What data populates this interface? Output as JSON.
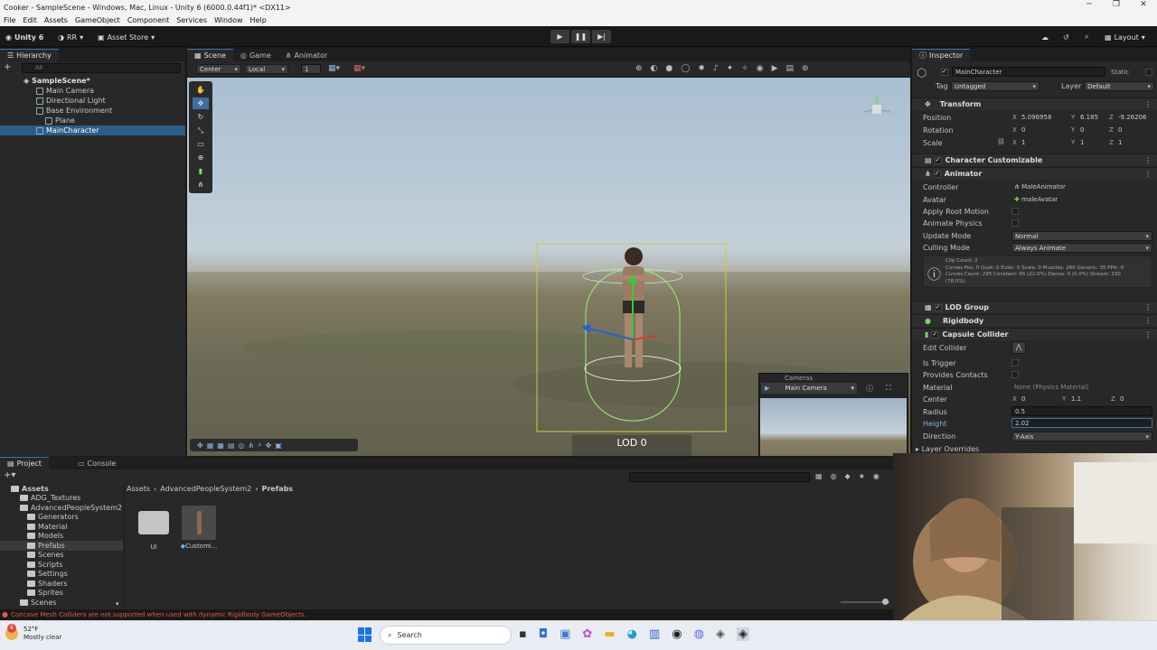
{
  "window": {
    "title": "Cooker - SampleScene - Windows, Mac, Linux - Unity 6 (6000.0.44f1)* <DX11>"
  },
  "menu": [
    "File",
    "Edit",
    "Assets",
    "GameObject",
    "Component",
    "Services",
    "Window",
    "Help"
  ],
  "toolbar": {
    "account": "Unity 6",
    "initials": "RR",
    "asset_store": "Asset Store",
    "layout": "Layout"
  },
  "hierarchy": {
    "tab": "Hierarchy",
    "search_placeholder": "All",
    "items": [
      {
        "label": "SampleScene*",
        "indent": 0
      },
      {
        "label": "Main Camera",
        "indent": 1
      },
      {
        "label": "Directional Light",
        "indent": 1
      },
      {
        "label": "Base Environment",
        "indent": 1
      },
      {
        "label": "Plane",
        "indent": 2
      },
      {
        "label": "MainCharacter",
        "indent": 1
      }
    ]
  },
  "scene": {
    "tabs": [
      "Scene",
      "Game",
      "Animator"
    ],
    "pivot": "Center",
    "space": "Local",
    "grid": "1",
    "lod_label": "LOD 0",
    "cameras_title": "Cameras",
    "camera_select": "Main Camera"
  },
  "inspector": {
    "tab": "Inspector",
    "object_name": "MainCharacter",
    "static_label": "Static",
    "tag_label": "Tag",
    "tag_value": "Untagged",
    "layer_label": "Layer",
    "layer_value": "Default",
    "transform": {
      "title": "Transform",
      "position_label": "Position",
      "pos_x": "5.096958",
      "pos_y": "6.185",
      "pos_z": "-9.26206",
      "rotation_label": "Rotation",
      "rot_x": "0",
      "rot_y": "0",
      "rot_z": "0",
      "scale_label": "Scale",
      "scl_x": "1",
      "scl_y": "1",
      "scl_z": "1"
    },
    "character_customizable": "Character Customizable",
    "animator": {
      "title": "Animator",
      "controller_label": "Controller",
      "controller_value": "MaleAnimator",
      "avatar_label": "Avatar",
      "avatar_value": "maleAvatar",
      "root_motion_label": "Apply Root Motion",
      "animate_physics_label": "Animate Physics",
      "update_mode_label": "Update Mode",
      "update_mode_value": "Normal",
      "culling_mode_label": "Culling Mode",
      "culling_mode_value": "Always Animate",
      "info_line1": "Clip Count: 2",
      "info_line2": "Curves Pos: 0 Quat: 0 Euler: 0 Scale: 0 Muscles: 260 Generic: 35 PPtr: 0",
      "info_line3": "Curves Count: 295 Constant: 65 (22.0%) Dense: 0 (0.0%) Stream: 230",
      "info_line4": "(78.0%)"
    },
    "lod_group": "LOD Group",
    "rigidbody": "Rigidbody",
    "capsule": {
      "title": "Capsule Collider",
      "edit_label": "Edit Collider",
      "is_trigger_label": "Is Trigger",
      "provides_contacts_label": "Provides Contacts",
      "material_label": "Material",
      "material_value": "None (Physics Material)",
      "center_label": "Center",
      "center_x": "0",
      "center_y": "1.1",
      "center_z": "0",
      "radius_label": "Radius",
      "radius_value": "0.5",
      "height_label": "Height",
      "height_value": "2.02",
      "direction_label": "Direction",
      "direction_value": "Y-Axis",
      "layer_overrides_label": "Layer Overrides"
    }
  },
  "project": {
    "tabs": [
      "Project",
      "Console"
    ],
    "breadcrumb": [
      "Assets",
      "AdvancedPeopleSystem2",
      "Prefabs"
    ],
    "tree": [
      {
        "label": "Assets",
        "indent": 0
      },
      {
        "label": "ADG_Textures",
        "indent": 1
      },
      {
        "label": "AdvancedPeopleSystem2",
        "indent": 1
      },
      {
        "label": "Generators",
        "indent": 2
      },
      {
        "label": "Material",
        "indent": 2
      },
      {
        "label": "Models",
        "indent": 2
      },
      {
        "label": "Prefabs",
        "indent": 2
      },
      {
        "label": "Scenes",
        "indent": 2
      },
      {
        "label": "Scripts",
        "indent": 2
      },
      {
        "label": "Settings",
        "indent": 2
      },
      {
        "label": "Shaders",
        "indent": 2
      },
      {
        "label": "Sprites",
        "indent": 2
      },
      {
        "label": "Scenes",
        "indent": 1
      }
    ],
    "assets": [
      {
        "label": "UI"
      },
      {
        "label": "Customi..."
      }
    ]
  },
  "status": {
    "message": "Concave Mesh Colliders are not supported when used with dynamic Rigidbody GameObjects."
  },
  "taskbar": {
    "temp": "52°F",
    "weather": "Mostly clear",
    "search": "Search",
    "badge": "6"
  },
  "colors": {
    "accent": "#3a79bb",
    "error": "#e05a4a",
    "bg": "#282828"
  }
}
